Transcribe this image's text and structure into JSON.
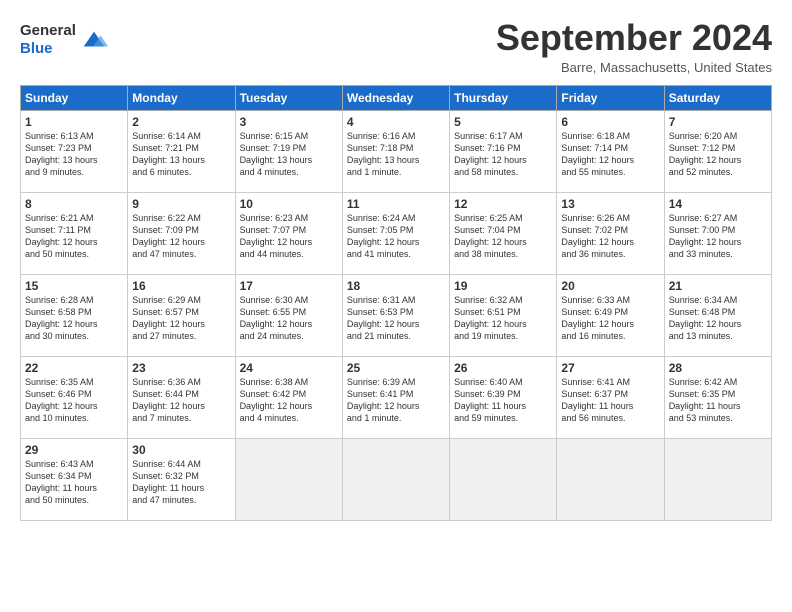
{
  "header": {
    "logo_general": "General",
    "logo_blue": "Blue",
    "month_title": "September 2024",
    "location": "Barre, Massachusetts, United States"
  },
  "days_of_week": [
    "Sunday",
    "Monday",
    "Tuesday",
    "Wednesday",
    "Thursday",
    "Friday",
    "Saturday"
  ],
  "weeks": [
    [
      {
        "day": "1",
        "info": "Sunrise: 6:13 AM\nSunset: 7:23 PM\nDaylight: 13 hours\nand 9 minutes."
      },
      {
        "day": "2",
        "info": "Sunrise: 6:14 AM\nSunset: 7:21 PM\nDaylight: 13 hours\nand 6 minutes."
      },
      {
        "day": "3",
        "info": "Sunrise: 6:15 AM\nSunset: 7:19 PM\nDaylight: 13 hours\nand 4 minutes."
      },
      {
        "day": "4",
        "info": "Sunrise: 6:16 AM\nSunset: 7:18 PM\nDaylight: 13 hours\nand 1 minute."
      },
      {
        "day": "5",
        "info": "Sunrise: 6:17 AM\nSunset: 7:16 PM\nDaylight: 12 hours\nand 58 minutes."
      },
      {
        "day": "6",
        "info": "Sunrise: 6:18 AM\nSunset: 7:14 PM\nDaylight: 12 hours\nand 55 minutes."
      },
      {
        "day": "7",
        "info": "Sunrise: 6:20 AM\nSunset: 7:12 PM\nDaylight: 12 hours\nand 52 minutes."
      }
    ],
    [
      {
        "day": "8",
        "info": "Sunrise: 6:21 AM\nSunset: 7:11 PM\nDaylight: 12 hours\nand 50 minutes."
      },
      {
        "day": "9",
        "info": "Sunrise: 6:22 AM\nSunset: 7:09 PM\nDaylight: 12 hours\nand 47 minutes."
      },
      {
        "day": "10",
        "info": "Sunrise: 6:23 AM\nSunset: 7:07 PM\nDaylight: 12 hours\nand 44 minutes."
      },
      {
        "day": "11",
        "info": "Sunrise: 6:24 AM\nSunset: 7:05 PM\nDaylight: 12 hours\nand 41 minutes."
      },
      {
        "day": "12",
        "info": "Sunrise: 6:25 AM\nSunset: 7:04 PM\nDaylight: 12 hours\nand 38 minutes."
      },
      {
        "day": "13",
        "info": "Sunrise: 6:26 AM\nSunset: 7:02 PM\nDaylight: 12 hours\nand 36 minutes."
      },
      {
        "day": "14",
        "info": "Sunrise: 6:27 AM\nSunset: 7:00 PM\nDaylight: 12 hours\nand 33 minutes."
      }
    ],
    [
      {
        "day": "15",
        "info": "Sunrise: 6:28 AM\nSunset: 6:58 PM\nDaylight: 12 hours\nand 30 minutes."
      },
      {
        "day": "16",
        "info": "Sunrise: 6:29 AM\nSunset: 6:57 PM\nDaylight: 12 hours\nand 27 minutes."
      },
      {
        "day": "17",
        "info": "Sunrise: 6:30 AM\nSunset: 6:55 PM\nDaylight: 12 hours\nand 24 minutes."
      },
      {
        "day": "18",
        "info": "Sunrise: 6:31 AM\nSunset: 6:53 PM\nDaylight: 12 hours\nand 21 minutes."
      },
      {
        "day": "19",
        "info": "Sunrise: 6:32 AM\nSunset: 6:51 PM\nDaylight: 12 hours\nand 19 minutes."
      },
      {
        "day": "20",
        "info": "Sunrise: 6:33 AM\nSunset: 6:49 PM\nDaylight: 12 hours\nand 16 minutes."
      },
      {
        "day": "21",
        "info": "Sunrise: 6:34 AM\nSunset: 6:48 PM\nDaylight: 12 hours\nand 13 minutes."
      }
    ],
    [
      {
        "day": "22",
        "info": "Sunrise: 6:35 AM\nSunset: 6:46 PM\nDaylight: 12 hours\nand 10 minutes."
      },
      {
        "day": "23",
        "info": "Sunrise: 6:36 AM\nSunset: 6:44 PM\nDaylight: 12 hours\nand 7 minutes."
      },
      {
        "day": "24",
        "info": "Sunrise: 6:38 AM\nSunset: 6:42 PM\nDaylight: 12 hours\nand 4 minutes."
      },
      {
        "day": "25",
        "info": "Sunrise: 6:39 AM\nSunset: 6:41 PM\nDaylight: 12 hours\nand 1 minute."
      },
      {
        "day": "26",
        "info": "Sunrise: 6:40 AM\nSunset: 6:39 PM\nDaylight: 11 hours\nand 59 minutes."
      },
      {
        "day": "27",
        "info": "Sunrise: 6:41 AM\nSunset: 6:37 PM\nDaylight: 11 hours\nand 56 minutes."
      },
      {
        "day": "28",
        "info": "Sunrise: 6:42 AM\nSunset: 6:35 PM\nDaylight: 11 hours\nand 53 minutes."
      }
    ],
    [
      {
        "day": "29",
        "info": "Sunrise: 6:43 AM\nSunset: 6:34 PM\nDaylight: 11 hours\nand 50 minutes."
      },
      {
        "day": "30",
        "info": "Sunrise: 6:44 AM\nSunset: 6:32 PM\nDaylight: 11 hours\nand 47 minutes."
      },
      {
        "day": "",
        "info": ""
      },
      {
        "day": "",
        "info": ""
      },
      {
        "day": "",
        "info": ""
      },
      {
        "day": "",
        "info": ""
      },
      {
        "day": "",
        "info": ""
      }
    ]
  ]
}
